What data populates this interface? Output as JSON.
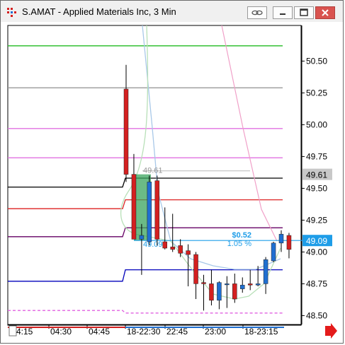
{
  "window": {
    "title": "S.AMAT - Applied Materials Inc, 3 Min",
    "buttons": {
      "link": "link-icon",
      "minimize": "minimize-icon",
      "maximize": "maximize-icon",
      "close": "close-icon"
    }
  },
  "colors": {
    "up": "#1f6fd1",
    "down": "#d42020",
    "price_box": "#1e9de8",
    "measure_fill": "#3aa45e"
  },
  "chart_data": {
    "type": "candlestick",
    "y_ticks": [
      "50.50",
      "50.25",
      "50.00",
      "49.75",
      "49.50",
      "49.25",
      "49.00",
      "48.75",
      "48.50"
    ],
    "x_ticks": [
      "4:15",
      "04:30",
      "04:45",
      "18-22:30",
      "22:45",
      "23:00",
      "18-23:15"
    ],
    "price_labels": {
      "high_marker": "49.61",
      "last": "49.09"
    },
    "measure": {
      "start_label": "49.61",
      "end_label": "49.09",
      "change": "$0.52",
      "change_pct": "1.05 %"
    },
    "candles": [
      {
        "o": 50.28,
        "h": 50.47,
        "l": 49.55,
        "c": 49.61
      },
      {
        "o": 49.61,
        "h": 49.77,
        "l": 49.15,
        "c": 49.1
      },
      {
        "o": 49.1,
        "h": 49.22,
        "l": 48.82,
        "c": 49.13
      },
      {
        "o": 49.08,
        "h": 49.6,
        "l": 49.05,
        "c": 49.55
      },
      {
        "o": 49.56,
        "h": 49.6,
        "l": 49.05,
        "c": 49.1
      },
      {
        "o": 49.08,
        "h": 49.35,
        "l": 49.02,
        "c": 49.03
      },
      {
        "o": 49.04,
        "h": 49.3,
        "l": 49.0,
        "c": 49.02
      },
      {
        "o": 49.05,
        "h": 49.1,
        "l": 48.96,
        "c": 48.99
      },
      {
        "o": 49.01,
        "h": 49.06,
        "l": 48.73,
        "c": 48.98
      },
      {
        "o": 48.98,
        "h": 49.0,
        "l": 48.63,
        "c": 48.75
      },
      {
        "o": 48.76,
        "h": 48.82,
        "l": 48.54,
        "c": 48.75
      },
      {
        "o": 48.75,
        "h": 48.86,
        "l": 48.58,
        "c": 48.62
      },
      {
        "o": 48.62,
        "h": 48.77,
        "l": 48.55,
        "c": 48.76
      },
      {
        "o": 48.75,
        "h": 48.81,
        "l": 48.56,
        "c": 48.75
      },
      {
        "o": 48.75,
        "h": 48.83,
        "l": 48.6,
        "c": 48.63
      },
      {
        "o": 48.71,
        "h": 48.8,
        "l": 48.68,
        "c": 48.74
      },
      {
        "o": 48.75,
        "h": 48.86,
        "l": 48.7,
        "c": 48.74
      },
      {
        "o": 48.74,
        "h": 48.89,
        "l": 48.73,
        "c": 48.75
      },
      {
        "o": 48.75,
        "h": 48.96,
        "l": 48.67,
        "c": 48.94
      },
      {
        "o": 48.93,
        "h": 49.08,
        "l": 48.92,
        "c": 49.07
      },
      {
        "o": 49.07,
        "h": 49.17,
        "l": 49.0,
        "c": 49.14
      },
      {
        "o": 49.13,
        "h": 49.15,
        "l": 48.95,
        "c": 49.02
      }
    ],
    "levels": [
      {
        "name": "green",
        "color": "#22bb22",
        "before": 50.62,
        "after": 50.62
      },
      {
        "name": "gray",
        "color": "#999999",
        "before": 50.29,
        "after": 50.29
      },
      {
        "name": "magenta",
        "color": "#e070e0",
        "before": 49.97,
        "after": 49.97
      },
      {
        "name": "magenta2",
        "color": "#e070e0",
        "before": 49.74,
        "after": 49.74
      },
      {
        "name": "black",
        "color": "#000000",
        "before": 49.51,
        "after": 49.58
      },
      {
        "name": "red",
        "color": "#dd2222",
        "before": 49.34,
        "after": 49.41
      },
      {
        "name": "purple",
        "color": "#660066",
        "before": 49.12,
        "after": 49.19
      },
      {
        "name": "blue",
        "color": "#0000bb",
        "before": 48.77,
        "after": 48.86
      },
      {
        "name": "pink-dashed",
        "color": "#e060e0",
        "before": 48.54,
        "after": 48.52
      }
    ],
    "ylim": [
      48.43,
      50.78
    ]
  }
}
